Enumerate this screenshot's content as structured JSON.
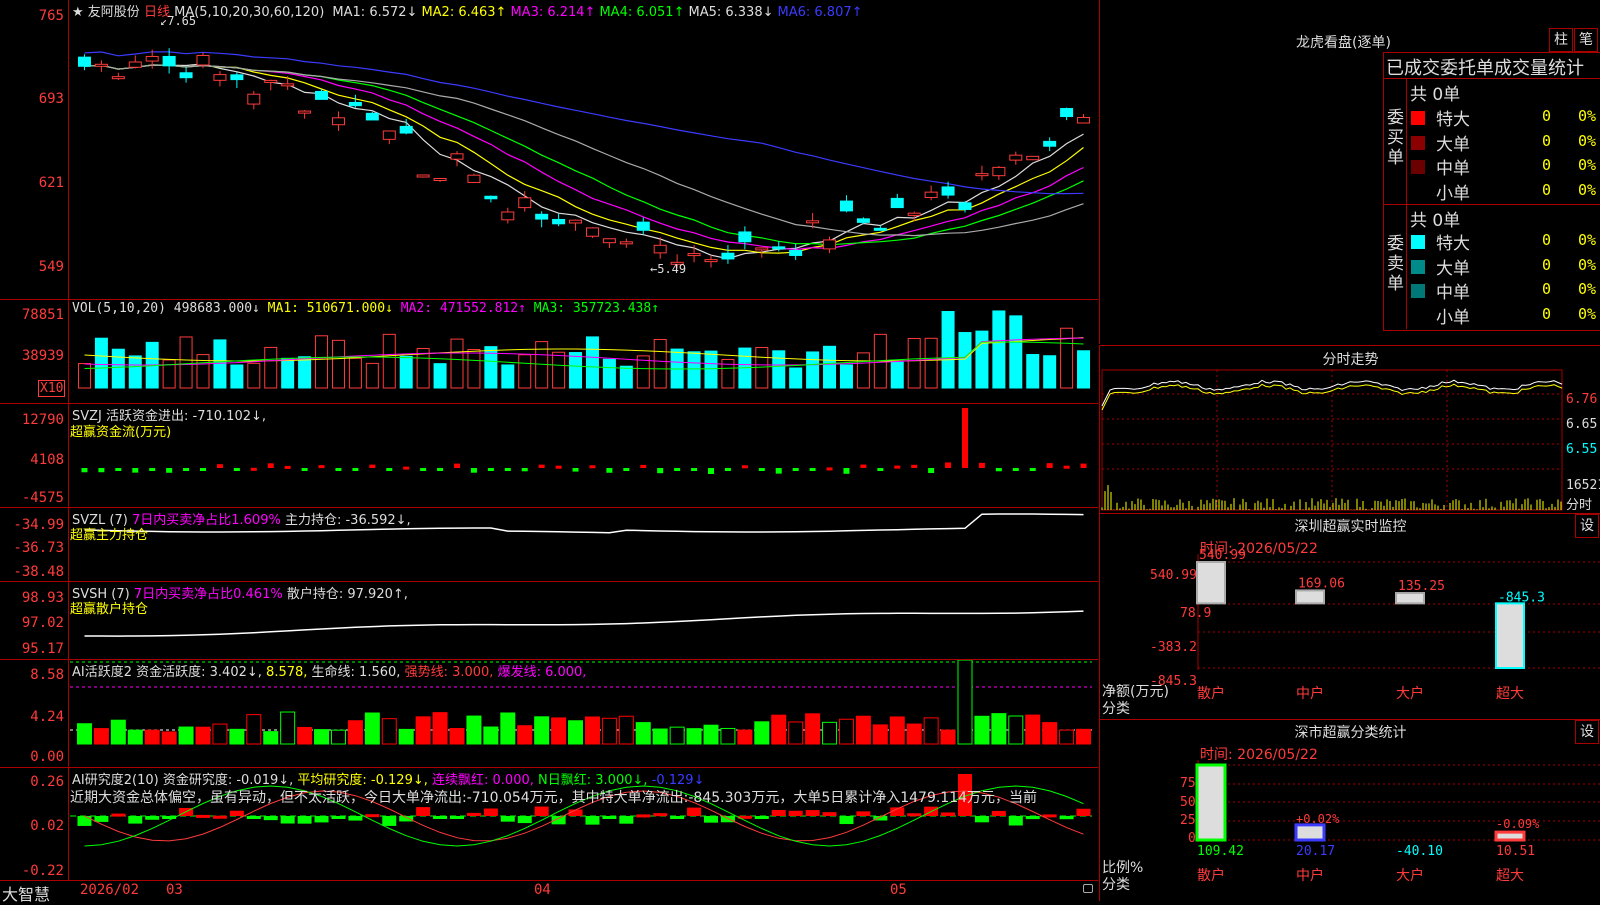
{
  "main_chart": {
    "stock_name": "友阿股份",
    "period": "日线",
    "ma_prefix": "MA(5,10,20,30,60,120)",
    "ma_items": [
      {
        "label": "MA1:",
        "value": "6.572↓",
        "color": "#dddddd"
      },
      {
        "label": "MA2:",
        "value": "6.463↑",
        "color": "#ffff00"
      },
      {
        "label": "MA3:",
        "value": "6.214↑",
        "color": "#ff00ff"
      },
      {
        "label": "MA4:",
        "value": "6.051↑",
        "color": "#00ff00"
      },
      {
        "label": "MA5:",
        "value": "6.338↓",
        "color": "#dddddd"
      },
      {
        "label": "MA6:",
        "value": "6.807↑",
        "color": "#3b3bff"
      }
    ],
    "y_labels": [
      "765",
      "693",
      "621",
      "549"
    ],
    "high_mark": "7.65",
    "low_mark": "5.49"
  },
  "vol_panel": {
    "prefix": "VOL(5,10,20)",
    "value": "498683.000↓",
    "ma1": "MA1: 510671.000↓",
    "ma2": "MA2: 471552.812↑",
    "ma3": "MA3: 357723.438↑",
    "y_labels": [
      "78851",
      "38939"
    ],
    "unit": "X10"
  },
  "svzj_panel": {
    "prefix": "SVZJ",
    "text": "活跃资金进出: -710.102↓,",
    "subtitle": "超赢资金流(万元)",
    "y_labels": [
      "12790",
      "4108",
      "-4575"
    ]
  },
  "svzl_panel": {
    "prefix": "SVZL (7)",
    "ratio": "7日内买卖净占比1.609%",
    "text": "主力持仓: -36.592↓,",
    "subtitle": "超赢主力持仓",
    "y_labels": [
      "-34.99",
      "-36.73",
      "-38.48"
    ]
  },
  "svsh_panel": {
    "prefix": "SVSH (7)",
    "ratio": "7日内买卖净占比0.461%",
    "text": "散户持仓: 97.920↑,",
    "subtitle": "超赢散户持仓",
    "y_labels": [
      "98.93",
      "97.02",
      "95.17"
    ]
  },
  "ai_active_panel": {
    "prefix": "AI活跃度2",
    "t1": "资金活跃度: 3.402↓,",
    "t2": "8.578,",
    "t3": "生命线: 1.560,",
    "t4": "强势线: 3.000,",
    "t5": "爆发线: 6.000,",
    "y_labels": [
      "8.58",
      "4.24",
      "0.00"
    ]
  },
  "ai_research_panel": {
    "prefix": "AI研究度2(10)",
    "t1": "资金研究度: -0.019↓,",
    "t2": "平均研究度: -0.129↓,",
    "t3": "连续飘红: 0.000,",
    "t4": "N日飘红: 3.000↓,",
    "t5": "-0.129↓",
    "comment": "近期大资金总体偏空，虽有异动，但不太活跃，今日大单净流出:-710.054万元，其中特大单净流出:-845.303万元，大单5日累计净入1479.114万元，当前",
    "y_labels": [
      "0.26",
      "0.02",
      "-0.22"
    ]
  },
  "date_axis": {
    "brand": "大智慧",
    "labels": [
      "2026/02",
      "03",
      "04",
      "05"
    ]
  },
  "dragon_tiger": {
    "title": "龙虎看盘(逐单)",
    "btn1": "柱",
    "btn2": "笔",
    "subtitle": "已成交委托单成交量统计",
    "buy_label": "委买单",
    "sell_label": "委卖单",
    "buy_total": "共 0单",
    "sell_total": "共 0单",
    "buy_rows": [
      {
        "name": "特大",
        "count": "0",
        "pct": "0%",
        "color": "#ff0000"
      },
      {
        "name": "大单",
        "count": "0",
        "pct": "0%",
        "color": "#8b0000"
      },
      {
        "name": "中单",
        "count": "0",
        "pct": "0%",
        "color": "#6b0000"
      },
      {
        "name": "小单",
        "count": "0",
        "pct": "0%",
        "color": "#000000"
      }
    ],
    "sell_rows": [
      {
        "name": "特大",
        "count": "0",
        "pct": "0%",
        "color": "#00ffff"
      },
      {
        "name": "大单",
        "count": "0",
        "pct": "0%",
        "color": "#008b8b"
      },
      {
        "name": "中单",
        "count": "0",
        "pct": "0%",
        "color": "#007878"
      },
      {
        "name": "小单",
        "count": "0",
        "pct": "0%",
        "color": "#000000"
      }
    ]
  },
  "intraday": {
    "title": "分时走势",
    "y_labels": [
      "6.76",
      "6.65",
      "6.55"
    ],
    "vol_label": "16521",
    "vol_unit": "分时"
  },
  "sz_monitor": {
    "title": "深圳超赢实时监控",
    "btn": "设",
    "time": "时间: 2026/05/22",
    "y_labels": [
      "540.99",
      "78.9",
      "-383.2",
      "-845.3"
    ],
    "ylabel_a": "净额(万元)",
    "ylabel_b": "分类",
    "categories": [
      "散户",
      "中户",
      "大户",
      "超大"
    ],
    "values": [
      540.99,
      169.06,
      135.25,
      -845.3
    ],
    "value_labels": [
      "540.99",
      "169.06",
      "135.25",
      "-845.3"
    ]
  },
  "sz_stats": {
    "title": "深市超赢分类统计",
    "btn": "设",
    "time": "时间: 2026/05/22",
    "y_labels": [
      "75",
      "50",
      "25",
      "0"
    ],
    "ylabel_a": "比例%",
    "ylabel_b": "分类",
    "categories": [
      "散户",
      "中户",
      "大户",
      "超大"
    ],
    "bottom_values": [
      "109.42",
      "20.17",
      "-40.10",
      "10.51"
    ],
    "bar_labels": [
      "",
      "+0.02%",
      "",
      "-0.09%"
    ],
    "values": [
      109.42,
      20.17,
      -40.1,
      10.51
    ]
  }
}
